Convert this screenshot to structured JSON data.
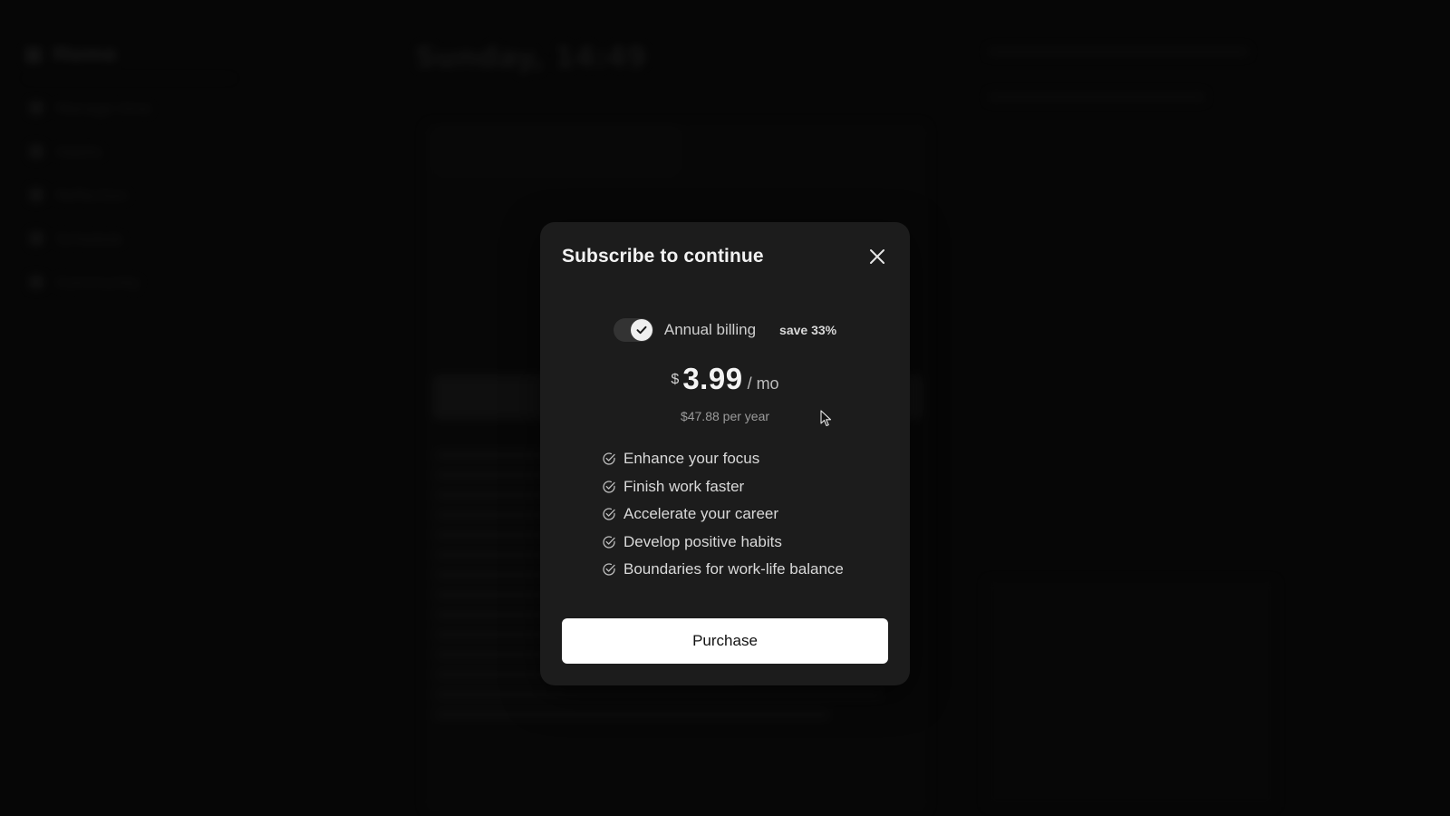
{
  "background": {
    "brand": "Home",
    "title": "Sunday, 14:49",
    "nav_items": [
      "Manage time",
      "Habits",
      "Reflection",
      "Schedule",
      "Community"
    ]
  },
  "modal": {
    "title": "Subscribe to continue",
    "billing": {
      "label": "Annual billing",
      "enabled": true,
      "save_badge": "save 33%"
    },
    "price": {
      "currency": "$",
      "amount": "3.99",
      "period": "/ mo",
      "yearly": "$47.88 per year"
    },
    "features": [
      "Enhance your focus",
      "Finish work faster",
      "Accelerate your career",
      "Develop positive habits",
      "Boundaries for work-life balance"
    ],
    "purchase_label": "Purchase"
  },
  "colors": {
    "modal_bg": "#1c1c1c",
    "page_bg": "#0b0b0b",
    "button_bg": "#ffffff",
    "button_text": "#111111"
  },
  "icons": {
    "close": "close-icon",
    "toggle_check": "check-icon",
    "feature_check": "circle-check-icon"
  }
}
